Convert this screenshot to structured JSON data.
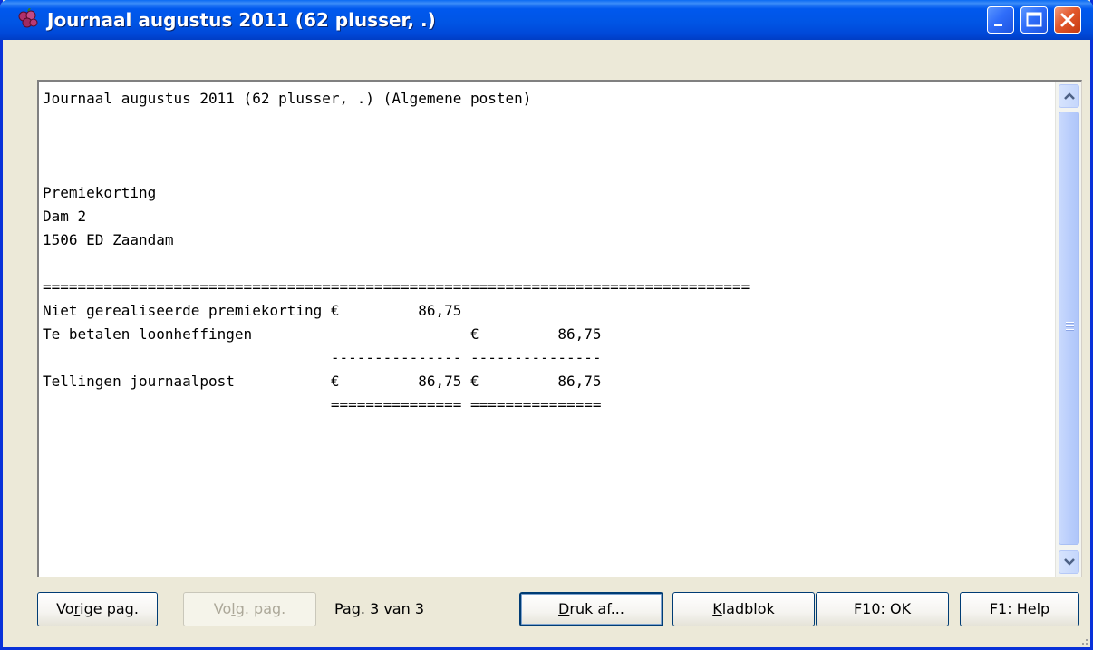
{
  "window": {
    "title": "Journaal augustus 2011 (62 plusser, .)",
    "icon": "grape-app-icon"
  },
  "titlebar_buttons": {
    "minimize": "minimize-icon",
    "maximize": "maximize-icon",
    "close": "close-icon"
  },
  "document": {
    "lines": [
      "Journaal augustus 2011 (62 plusser, .) (Algemene posten)",
      "",
      "",
      "",
      "Premiekorting",
      "Dam 2",
      "1506 ED Zaandam",
      "",
      "=================================================================================",
      "Niet gerealiseerde premiekorting €         86,75",
      "Te betalen loonheffingen                         €         86,75",
      "                                 --------------- ---------------",
      "Tellingen journaalpost           €         86,75 €         86,75",
      "                                 =============== ==============="
    ]
  },
  "buttons": {
    "prev": {
      "pre": "Vo",
      "u": "r",
      "post": "ige pag."
    },
    "next": {
      "pre": "Vo",
      "u": "l",
      "post": "g. pag."
    },
    "print": {
      "pre": "",
      "u": "D",
      "post": "ruk af..."
    },
    "notepad": {
      "pre": "",
      "u": "K",
      "post": "ladblok"
    },
    "ok": "F10: OK",
    "help": "F1: Help"
  },
  "page_indicator": "Pag. 3 van 3",
  "colors": {
    "titlebar": "#0055e5",
    "window_bg": "#ece9d8",
    "button_border": "#003c74"
  }
}
